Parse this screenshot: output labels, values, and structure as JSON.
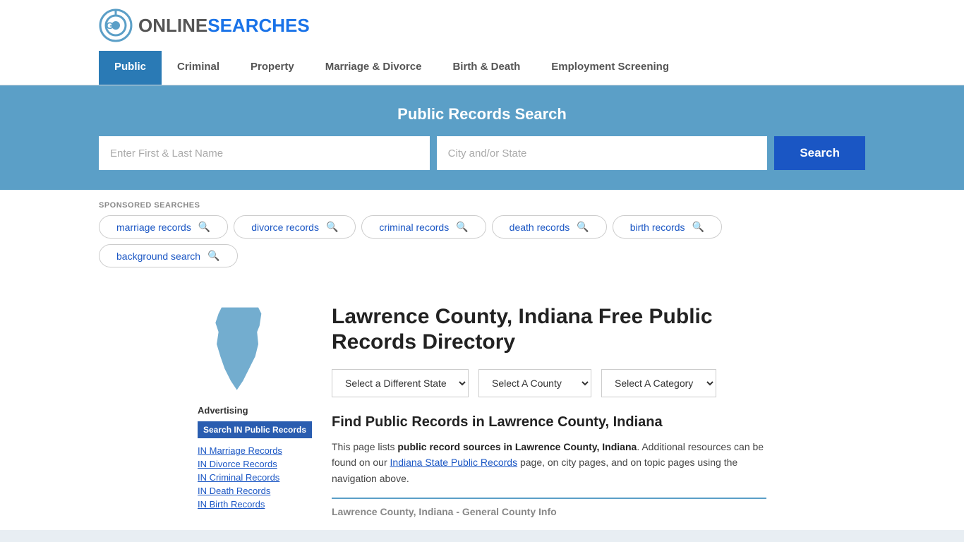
{
  "logo": {
    "online": "ONLINE",
    "searches": "SEARCHES"
  },
  "nav": {
    "items": [
      {
        "label": "Public",
        "active": true
      },
      {
        "label": "Criminal",
        "active": false
      },
      {
        "label": "Property",
        "active": false
      },
      {
        "label": "Marriage & Divorce",
        "active": false
      },
      {
        "label": "Birth & Death",
        "active": false
      },
      {
        "label": "Employment Screening",
        "active": false
      }
    ]
  },
  "search_banner": {
    "title": "Public Records Search",
    "name_placeholder": "Enter First & Last Name",
    "location_placeholder": "City and/or State",
    "button_label": "Search"
  },
  "sponsored": {
    "label": "SPONSORED SEARCHES",
    "tags": [
      {
        "label": "marriage records"
      },
      {
        "label": "divorce records"
      },
      {
        "label": "criminal records"
      },
      {
        "label": "death records"
      },
      {
        "label": "birth records"
      },
      {
        "label": "background search"
      }
    ]
  },
  "page": {
    "title": "Lawrence County, Indiana Free Public Records Directory",
    "dropdowns": {
      "state": "Select a Different State",
      "county": "Select A County",
      "category": "Select A Category"
    },
    "section_heading": "Find Public Records in Lawrence County, Indiana",
    "body_text_1": "This page lists ",
    "body_bold": "public record sources in Lawrence County, Indiana",
    "body_text_2": ". Additional resources can be found on our ",
    "body_link": "Indiana State Public Records",
    "body_text_3": " page, on city pages, and on topic pages using the navigation above.",
    "county_info_label": "Lawrence County, Indiana - General County Info"
  },
  "sidebar": {
    "advertising_label": "Advertising",
    "ad_button": "Search IN Public Records",
    "links": [
      {
        "label": "IN Marriage Records"
      },
      {
        "label": "IN Divorce Records"
      },
      {
        "label": "IN Criminal Records"
      },
      {
        "label": "IN Death Records"
      },
      {
        "label": "IN Birth Records"
      }
    ]
  },
  "colors": {
    "accent_blue": "#2a7ab5",
    "dark_blue": "#1a56c4",
    "banner_bg": "#5b9fc7"
  }
}
